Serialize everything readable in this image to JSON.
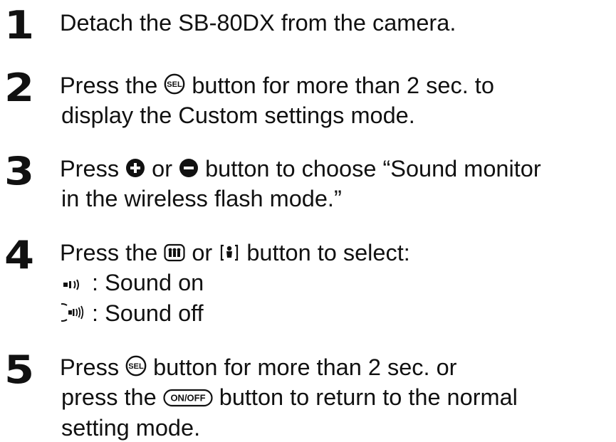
{
  "steps": [
    {
      "number": "1",
      "lines": [
        {
          "parts": [
            {
              "text": "Detach the SB-80DX from the camera."
            }
          ]
        }
      ]
    },
    {
      "number": "2",
      "lines": [
        {
          "parts": [
            {
              "text": "Press the "
            },
            {
              "icon": "sel-button-icon",
              "text": "SEL"
            },
            {
              "text": " button for more than 2 sec. to"
            }
          ]
        },
        {
          "parts": [
            {
              "text": "display the Custom settings mode."
            }
          ]
        }
      ]
    },
    {
      "number": "3",
      "lines": [
        {
          "parts": [
            {
              "text": "Press "
            },
            {
              "icon": "plus-button-icon"
            },
            {
              "text": " or "
            },
            {
              "icon": "minus-button-icon"
            },
            {
              "text": " button to choose “Sound monitor"
            }
          ]
        },
        {
          "parts": [
            {
              "text": "in the wireless flash mode.”"
            }
          ]
        }
      ]
    },
    {
      "number": "4",
      "lines": [
        {
          "parts": [
            {
              "text": "Press the "
            },
            {
              "icon": "zoom-wide-button-icon"
            },
            {
              "text": " or "
            },
            {
              "icon": "zoom-tele-button-icon"
            },
            {
              "text": " button to select:"
            }
          ]
        },
        {
          "parts": [
            {
              "icon": "sound-on-icon"
            },
            {
              "text": " : Sound on"
            }
          ]
        },
        {
          "parts": [
            {
              "icon": "sound-off-icon"
            },
            {
              "text": " : Sound off"
            }
          ]
        }
      ]
    },
    {
      "number": "5",
      "lines": [
        {
          "parts": [
            {
              "text": "Press "
            },
            {
              "icon": "sel-button-icon",
              "text": "SEL"
            },
            {
              "text": " button for more than 2 sec. or"
            }
          ]
        },
        {
          "parts": [
            {
              "text": "press the "
            },
            {
              "icon": "on-off-button-icon",
              "text": "ON/OFF"
            },
            {
              "text": " button to return to the normal"
            }
          ]
        },
        {
          "parts": [
            {
              "text": "setting mode."
            }
          ]
        }
      ]
    }
  ]
}
